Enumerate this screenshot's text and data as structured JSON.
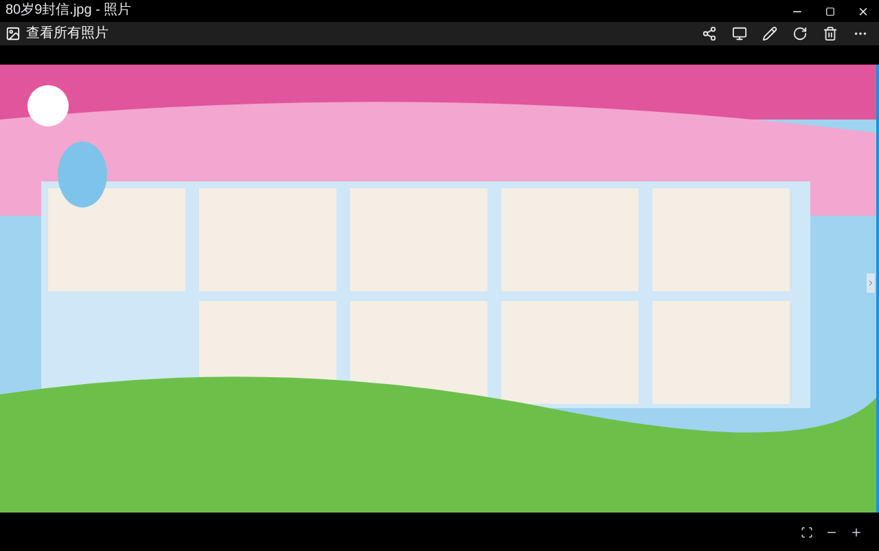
{
  "window": {
    "title": "80岁9封信.jpg - 照片"
  },
  "toolbar": {
    "back_button": "查看所有照片"
  }
}
